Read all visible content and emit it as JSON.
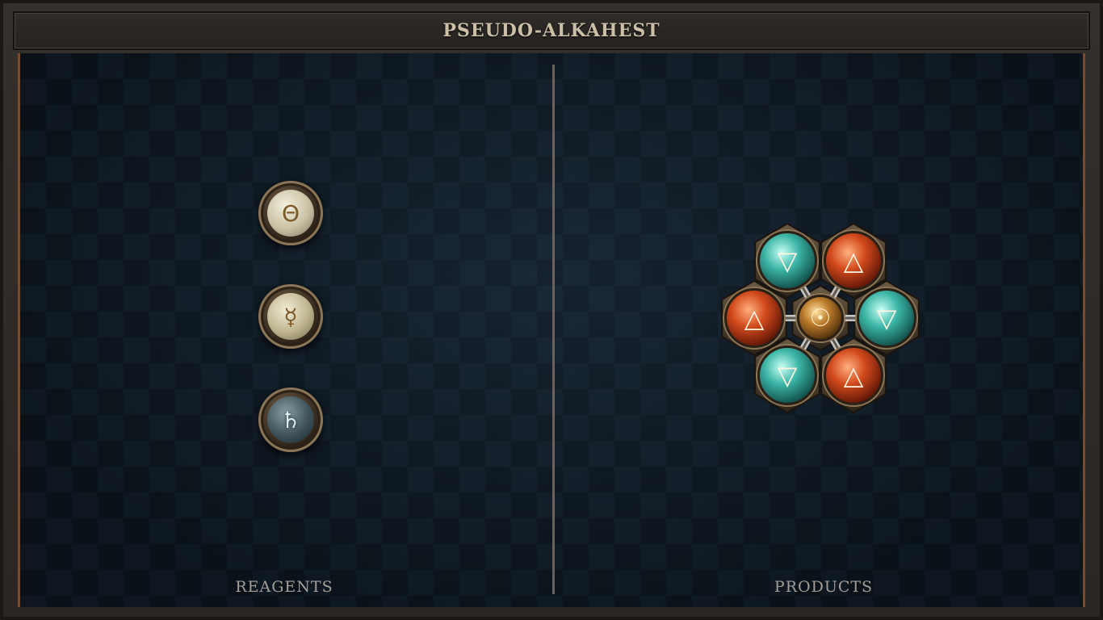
{
  "window": {
    "title": "PSEUDO-ALKAHEST"
  },
  "reagents": {
    "label": "REAGENTS",
    "items": [
      {
        "name": "salt",
        "glyph": "Θ",
        "color": "#e9e3c9"
      },
      {
        "name": "quicksilver",
        "glyph": "☿",
        "color": "#e1d9b8"
      },
      {
        "name": "lead",
        "glyph": "♄",
        "color": "#5a6e74"
      }
    ]
  },
  "products": {
    "label": "PRODUCTS",
    "center": {
      "name": "gold",
      "glyph": "☉"
    },
    "atoms": [
      {
        "name": "water",
        "glyph": "▽",
        "color": "#3bb5a6"
      },
      {
        "name": "fire",
        "glyph": "△",
        "color": "#d24a1c"
      },
      {
        "name": "water",
        "glyph": "▽",
        "color": "#3bb5a6"
      },
      {
        "name": "fire",
        "glyph": "△",
        "color": "#d24a1c"
      },
      {
        "name": "water",
        "glyph": "▽",
        "color": "#3bb5a6"
      },
      {
        "name": "fire",
        "glyph": "△",
        "color": "#d24a1c"
      }
    ]
  },
  "colors": {
    "accent": "#c9b48a",
    "wood": "#7a4a2a",
    "board": "#0f1a24"
  }
}
